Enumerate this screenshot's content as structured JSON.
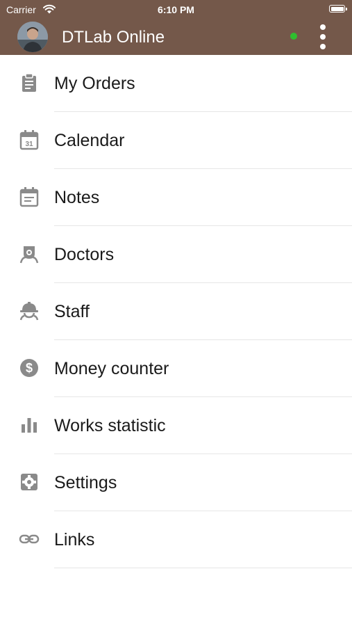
{
  "status_bar": {
    "carrier": "Carrier",
    "time": "6:10 PM",
    "wifi_icon": "wifi-icon",
    "battery_icon": "battery-icon"
  },
  "header": {
    "title": "DTLab Online",
    "background_color": "#74584a",
    "online_status_color": "#2fbf2f",
    "menu_icon": "more-vertical-icon"
  },
  "menu": {
    "items": [
      {
        "label": "My Orders",
        "icon": "clipboard-icon"
      },
      {
        "label": "Calendar",
        "icon": "calendar-icon",
        "icon_text": "31"
      },
      {
        "label": "Notes",
        "icon": "notes-icon"
      },
      {
        "label": "Doctors",
        "icon": "doctor-icon"
      },
      {
        "label": "Staff",
        "icon": "hardhat-icon"
      },
      {
        "label": "Money counter",
        "icon": "dollar-icon"
      },
      {
        "label": "Works statistic",
        "icon": "bar-chart-icon"
      },
      {
        "label": "Settings",
        "icon": "gear-icon"
      },
      {
        "label": "Links",
        "icon": "link-icon"
      }
    ]
  }
}
